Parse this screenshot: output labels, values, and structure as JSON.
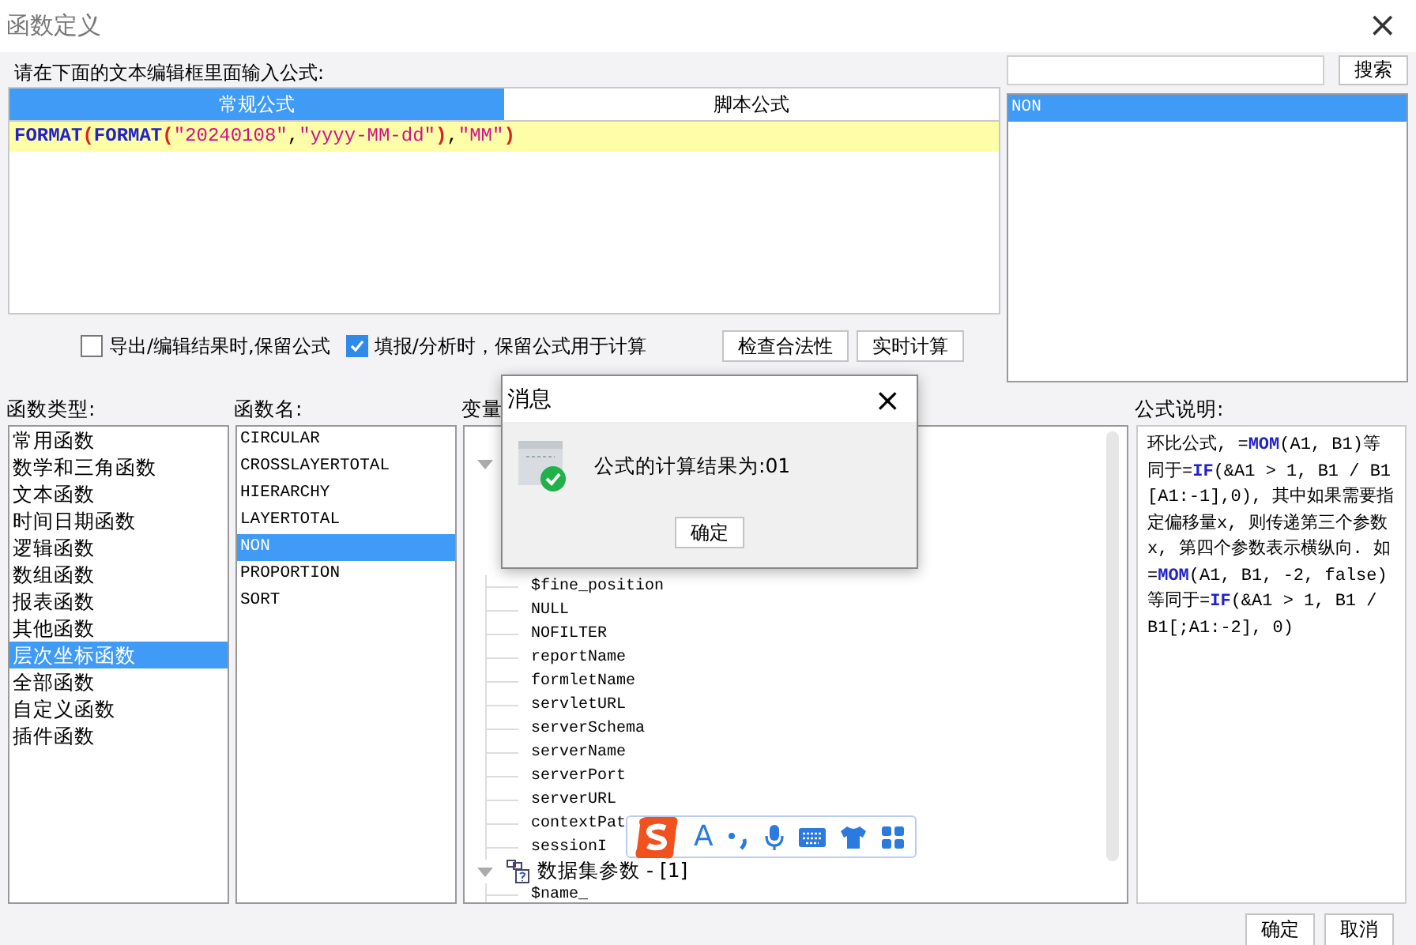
{
  "window": {
    "title": "函数定义",
    "close": "×"
  },
  "editor": {
    "prompt": "请在下面的文本编辑框里面输入公式:",
    "tabs": [
      {
        "label": "常规公式",
        "selected": true
      },
      {
        "label": "脚本公式",
        "selected": false
      }
    ],
    "formula": [
      {
        "kind": "func",
        "text": "FORMAT"
      },
      {
        "kind": "paren",
        "text": "("
      },
      {
        "kind": "func",
        "text": "FORMAT"
      },
      {
        "kind": "paren",
        "text": "("
      },
      {
        "kind": "string",
        "text": "\"20240108\""
      },
      {
        "kind": "plain",
        "text": ","
      },
      {
        "kind": "string",
        "text": "\"yyyy-MM-dd\""
      },
      {
        "kind": "paren",
        "text": ")"
      },
      {
        "kind": "plain",
        "text": ","
      },
      {
        "kind": "string",
        "text": "\"MM\""
      },
      {
        "kind": "paren",
        "text": ")"
      }
    ],
    "options": [
      {
        "label": "导出/编辑结果时,保留公式",
        "checked": false
      },
      {
        "label": "填报/分析时，保留公式用于计算",
        "checked": true
      }
    ],
    "buttons": [
      "检查合法性",
      "实时计算"
    ]
  },
  "search": {
    "button": "搜索",
    "results": [
      {
        "label": "NON",
        "selected": true
      }
    ]
  },
  "function_types": {
    "label": "函数类型:",
    "items": [
      {
        "label": "常用函数",
        "selected": false
      },
      {
        "label": "数学和三角函数",
        "selected": false
      },
      {
        "label": "文本函数",
        "selected": false
      },
      {
        "label": "时间日期函数",
        "selected": false
      },
      {
        "label": "逻辑函数",
        "selected": false
      },
      {
        "label": "数组函数",
        "selected": false
      },
      {
        "label": "报表函数",
        "selected": false
      },
      {
        "label": "其他函数",
        "selected": false
      },
      {
        "label": "层次坐标函数",
        "selected": true
      },
      {
        "label": "全部函数",
        "selected": false
      },
      {
        "label": "自定义函数",
        "selected": false
      },
      {
        "label": "插件函数",
        "selected": false
      }
    ]
  },
  "function_names": {
    "label": "函数名:",
    "items": [
      {
        "label": "CIRCULAR",
        "selected": false
      },
      {
        "label": "CROSSLAYERTOTAL",
        "selected": false
      },
      {
        "label": "HIERARCHY",
        "selected": false
      },
      {
        "label": "LAYERTOTAL",
        "selected": false
      },
      {
        "label": "NON",
        "selected": true
      },
      {
        "label": "PROPORTION",
        "selected": false
      },
      {
        "label": "SORT",
        "selected": false
      }
    ]
  },
  "variables": {
    "label": "变量",
    "tree": [
      {
        "expanded": true,
        "children": [
          {
            "label": "$fine_position"
          },
          {
            "label": "NULL"
          },
          {
            "label": "NOFILTER"
          },
          {
            "label": "reportName"
          },
          {
            "label": "formletName"
          },
          {
            "label": "servletURL"
          },
          {
            "label": "serverSchema"
          },
          {
            "label": "serverName"
          },
          {
            "label": "serverPort"
          },
          {
            "label": "serverURL"
          },
          {
            "label": "contextPat"
          },
          {
            "label": "sessionI"
          }
        ]
      },
      {
        "label": "数据集参数 - [1]",
        "expanded": true,
        "children": [
          {
            "label": "$name_"
          }
        ]
      }
    ]
  },
  "description": {
    "label": "公式说明:",
    "text": "环比公式, =**MOM**(A1, B1)等同于=**IF**(&A1 > 1, B1 / B1[A1:-1],0), 其中如果需要指定偏移量x, 则传递第三个参数x, 第四个参数表示横纵向. 如=**MOM**(A1, B1, -2, false)等同于=**IF**(&A1 > 1, B1 / B1[;A1:-2], 0)"
  },
  "footer": {
    "buttons": [
      "确定",
      "取消"
    ]
  },
  "message_dialog": {
    "title": "消息",
    "close": "×",
    "message": "公式的计算结果为:01",
    "button": "确定"
  },
  "ime_toolbar": {
    "items": [
      {
        "kind": "logo"
      },
      {
        "kind": "letter",
        "text": "A"
      },
      {
        "kind": "punct"
      },
      {
        "kind": "mic"
      },
      {
        "kind": "keyboard"
      },
      {
        "kind": "shirt"
      },
      {
        "kind": "grid"
      }
    ]
  }
}
